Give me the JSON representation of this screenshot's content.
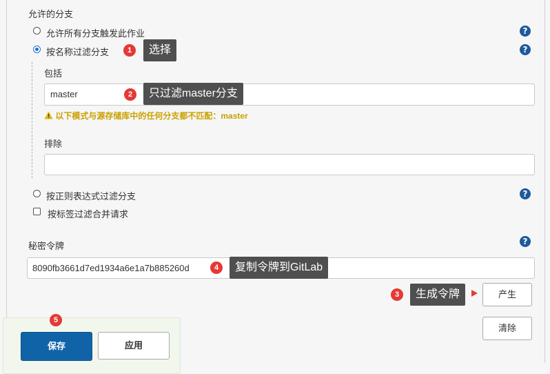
{
  "section_title": "允许的分支",
  "branch_options": {
    "all": "允许所有分支触发此作业",
    "by_name": "按名称过滤分支",
    "by_regex": "按正则表达式过滤分支",
    "by_label": "按标签过滤合并请求"
  },
  "include": {
    "label": "包括",
    "value": "master",
    "warning": "以下模式与源存储库中的任何分支都不匹配：master"
  },
  "exclude": {
    "label": "排除",
    "value": ""
  },
  "secret_token": {
    "label": "秘密令牌",
    "value": "8090fb3661d7ed1934a6e1a7b885260d"
  },
  "buttons": {
    "generate": "产生",
    "clear": "清除",
    "save": "保存",
    "apply": "应用"
  },
  "annotations": {
    "a1": {
      "number": "1",
      "text": "选择"
    },
    "a2": {
      "number": "2",
      "text": "只过滤master分支"
    },
    "a3": {
      "number": "3",
      "text": "生成令牌"
    },
    "a4": {
      "number": "4",
      "text": "复制令牌到GitLab"
    },
    "a5": {
      "number": "5"
    }
  },
  "help_icon": "?",
  "warning_icon": "warning-triangle",
  "colors": {
    "primary_button": "#1163a8",
    "annotation_badge": "#e53935",
    "annotation_tip": "#4f4f4f",
    "warning_text": "#c9a100",
    "help_icon": "#1e5a9a"
  }
}
